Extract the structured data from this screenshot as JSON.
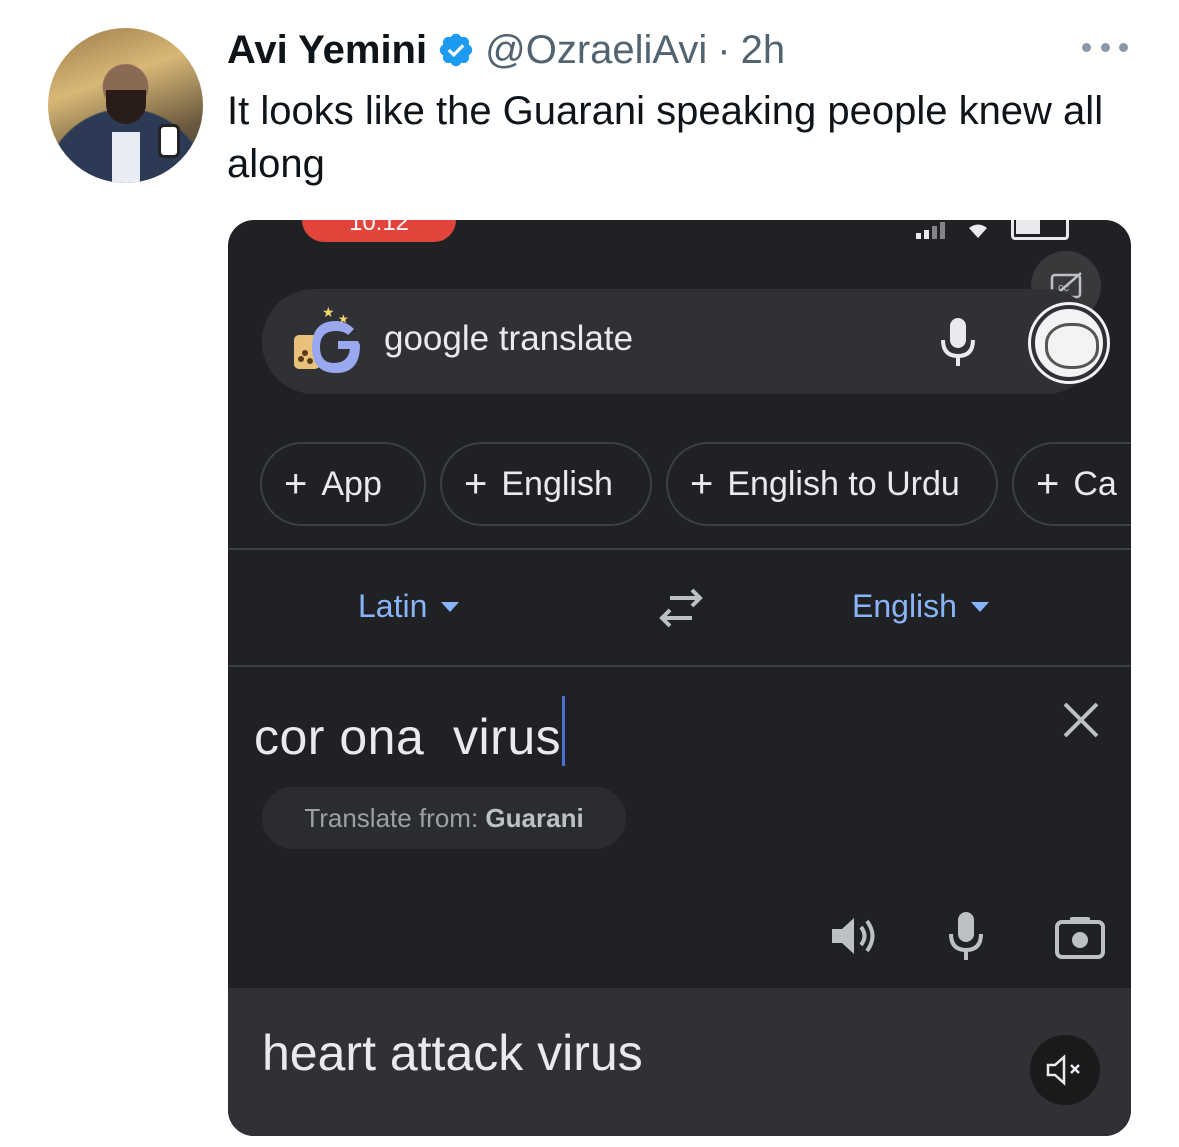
{
  "tweet": {
    "author_name": "Avi Yemini",
    "handle": "@OzraeliAvi",
    "separator": "·",
    "time": "2h",
    "text": "It looks like the Guarani speaking people knew all along"
  },
  "screenshot": {
    "status_bar": {
      "time": "10:12"
    },
    "search": {
      "query": "google translate"
    },
    "chips": [
      {
        "label": "App"
      },
      {
        "label": "English"
      },
      {
        "label": "English to Urdu"
      },
      {
        "label": "Ca"
      }
    ],
    "languages": {
      "source": "Latin",
      "target": "English"
    },
    "input": {
      "text": "cor ona  virus"
    },
    "detect": {
      "prefix": "Translate from:",
      "language": "Guarani"
    },
    "output": {
      "text": "heart attack virus"
    }
  },
  "colors": {
    "accent_blue": "#8ab4f8",
    "verified": "#1d9bf0",
    "dark_bg": "#202124",
    "clock_pill": "#e0443a"
  },
  "icons": [
    "verified-badge-icon",
    "more-options-icon",
    "closed-captions-icon",
    "microphone-icon",
    "swap-languages-icon",
    "clear-icon",
    "speaker-icon",
    "camera-icon",
    "muted-speaker-icon"
  ]
}
